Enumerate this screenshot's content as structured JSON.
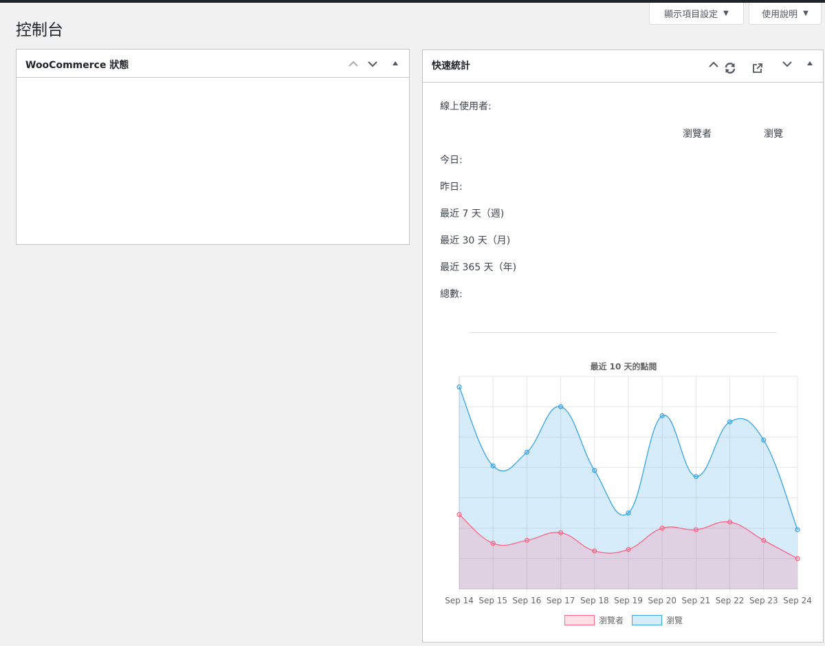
{
  "page": {
    "title": "控制台"
  },
  "screen_options": {
    "display_label": "顯示項目設定",
    "help_label": "使用說明"
  },
  "woocommerce_box": {
    "title": "WooCommerce 狀態"
  },
  "quick_stats_box": {
    "title": "快速統計",
    "online_users_label": "線上使用者:",
    "col_visitors": "瀏覽者",
    "col_views": "瀏覽",
    "rows": [
      "今日:",
      "昨日:",
      "最近 7 天（週)",
      "最近 30 天（月)",
      "最近 365 天（年)",
      "總數:"
    ]
  },
  "colors": {
    "views": "#36a2eb",
    "views_fill": "rgba(54,162,235,0.2)",
    "visitors": "#ff6384",
    "visitors_fill": "rgba(255,99,132,0.2)"
  },
  "chart_data": {
    "type": "area",
    "title": "最近 10 天的點閱",
    "x": [
      "Sep 14",
      "Sep 15",
      "Sep 16",
      "Sep 17",
      "Sep 18",
      "Sep 19",
      "Sep 20",
      "Sep 21",
      "Sep 22",
      "Sep 23",
      "Sep 24"
    ],
    "ylim": [
      0,
      7
    ],
    "grid": true,
    "legend": "bottom",
    "series": [
      {
        "name": "瀏覽者",
        "values": [
          2.45,
          1.5,
          1.6,
          1.85,
          1.25,
          1.3,
          2.0,
          1.95,
          2.2,
          1.6,
          1.0
        ]
      },
      {
        "name": "瀏覽",
        "values": [
          6.65,
          4.05,
          4.5,
          6.0,
          3.9,
          2.5,
          5.7,
          3.7,
          5.5,
          4.9,
          1.95
        ]
      }
    ]
  }
}
